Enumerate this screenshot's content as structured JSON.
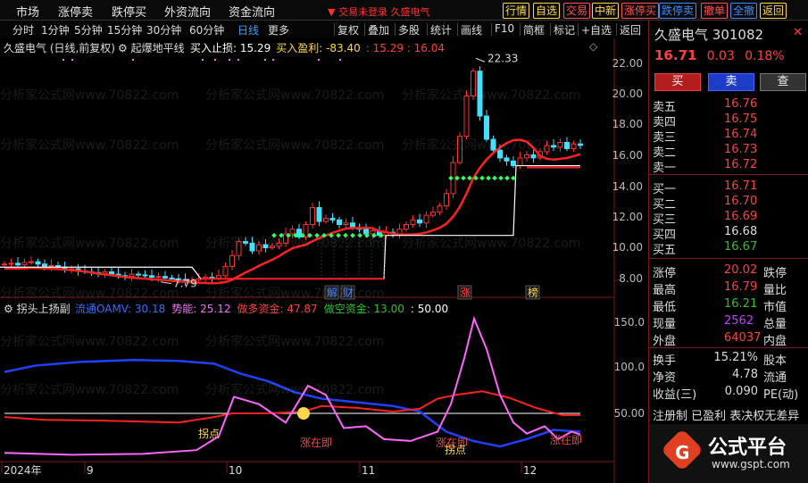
{
  "menu": {
    "items": [
      "市场",
      "涨停卖",
      "跌停买",
      "外资流向",
      "资金流向"
    ],
    "status": "交易未登录  久盛电气",
    "buttons": [
      "行情",
      "自选",
      "交易",
      "中新",
      "涨停买",
      "跌停卖",
      "撤单",
      "全撤",
      "返回"
    ],
    "button_colors": [
      "#ffd84a",
      "#ffd84a",
      "#ff5050",
      "#ffd84a",
      "#ff5050",
      "#3a8cff",
      "#ff5050",
      "#3a8cff",
      "#ffd84a"
    ]
  },
  "toolbar": {
    "periods": [
      "分时",
      "1分钟",
      "5分钟",
      "15分钟",
      "30分钟",
      "60分钟",
      "日线",
      "更多"
    ],
    "active_period": "日线",
    "tools": [
      "复权",
      "叠加",
      "多股",
      "统计",
      "画线",
      "F10",
      "简框",
      "标记",
      "+自选",
      "返回"
    ]
  },
  "main_chart": {
    "stock_label": "久盛电气 (日线,前复权)",
    "indicator_label": "起爆地平线",
    "legend": [
      {
        "text": "买入止损: 15.29",
        "color": "#ffffff"
      },
      {
        "text": "买入盈利: -83.40",
        "color": "#ffd84a"
      },
      {
        "text": ": 15.29 : 16.04",
        "color": "#ff4040"
      }
    ],
    "yticks": [
      "22.00",
      "20.00",
      "18.00",
      "16.00",
      "14.00",
      "12.00",
      "10.00",
      "8.00"
    ],
    "high_label": "22.33",
    "low_label": "7.79",
    "events": [
      "解",
      "财",
      "涨",
      "榜"
    ]
  },
  "sub_chart": {
    "label": "拐头上扬副",
    "legend": [
      {
        "text": "流通OAMV: 30.18",
        "color": "#3a6cff"
      },
      {
        "text": "势能: 25.12",
        "color": "#ff66ff"
      },
      {
        "text": "做多资金: 47.87",
        "color": "#ff4040"
      },
      {
        "text": "做空资金: 13.00",
        "color": "#30c030"
      },
      {
        "text": ": 50.00",
        "color": "#ffffff"
      }
    ],
    "yticks": [
      "150.0",
      "100.0",
      "50.00"
    ],
    "annotations": [
      "拐点",
      "涨在即",
      "涨在即",
      "拐点",
      "涨在即"
    ]
  },
  "xaxis": {
    "labels": [
      "2024年",
      "9",
      "10",
      "11",
      "12"
    ]
  },
  "quote": {
    "name": "久盛电气",
    "code": "301082",
    "price": "16.71",
    "change": "0.03",
    "pct": "0.18%",
    "actions": [
      "买",
      "卖",
      "查"
    ],
    "asks": [
      {
        "label": "卖五",
        "val": "16.76",
        "color": "#ff4040"
      },
      {
        "label": "卖四",
        "val": "16.75",
        "color": "#ff4040"
      },
      {
        "label": "卖三",
        "val": "16.74",
        "color": "#ff4040"
      },
      {
        "label": "卖二",
        "val": "16.73",
        "color": "#ff4040"
      },
      {
        "label": "卖一",
        "val": "16.72",
        "color": "#ff4040"
      }
    ],
    "bids": [
      {
        "label": "买一",
        "val": "16.71",
        "color": "#ff4040"
      },
      {
        "label": "买二",
        "val": "16.70",
        "color": "#ff4040"
      },
      {
        "label": "买三",
        "val": "16.69",
        "color": "#ff4040"
      },
      {
        "label": "买四",
        "val": "16.68",
        "color": "#dddddd"
      },
      {
        "label": "买五",
        "val": "16.67",
        "color": "#30c030"
      }
    ],
    "stats": [
      {
        "label": "涨停",
        "val": "20.02",
        "color": "#ff4040",
        "label2": "跌停"
      },
      {
        "label": "最高",
        "val": "16.79",
        "color": "#ff4040",
        "label2": "量比"
      },
      {
        "label": "最低",
        "val": "16.21",
        "color": "#30c030",
        "label2": "市值"
      },
      {
        "label": "现量",
        "val": "2562",
        "color": "#c040ff",
        "label2": "总量"
      },
      {
        "label": "外盘",
        "val": "64037",
        "color": "#ff4040",
        "label2": "内盘"
      }
    ],
    "stats2": [
      {
        "label": "换手",
        "val": "15.21%",
        "label2": "股本"
      },
      {
        "label": "净资",
        "val": "4.78",
        "label2": "流通"
      },
      {
        "label": "收益(三)",
        "val": "0.090",
        "label2": "PE(动)"
      }
    ],
    "footer": "注册制  已盈利  表决权无差异"
  },
  "badge": {
    "text": "公式平台",
    "url": "www.gspt.com"
  },
  "watermark": "分析家公式网www.70822.com"
}
